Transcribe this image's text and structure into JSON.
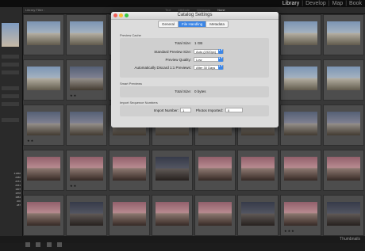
{
  "lightroom": {
    "module_picker": {
      "library": "Library",
      "develop": "Develop",
      "map": "Map",
      "book": "Book"
    },
    "filter_bar": {
      "left_label": "Library Filter :",
      "tabs": [
        "Text",
        "Attribute",
        "Metadata",
        "None"
      ],
      "active_tab": "None"
    },
    "left_panel": {
      "numbers": [
        "41860",
        "2080",
        "2151",
        "2041",
        "1907",
        "1878",
        "1884",
        "200",
        "287"
      ]
    },
    "grid": {
      "rating_label": "★★",
      "ratings": [
        "",
        "",
        "",
        "",
        "",
        "",
        "",
        "",
        "",
        "★★",
        "",
        "",
        "",
        "",
        "",
        "",
        "★★",
        "",
        "",
        "",
        "",
        "",
        "",
        "",
        "",
        "★★",
        "",
        "",
        "",
        "",
        "",
        "",
        "",
        "",
        "",
        "",
        "",
        "",
        "★★★",
        ""
      ]
    },
    "bottom_bar": {
      "right_label": "Thumbnails"
    }
  },
  "dialog": {
    "title": "Catalog Settings",
    "tabs": [
      "General",
      "File Handling",
      "Metadata"
    ],
    "active_tab": "File Handling",
    "preview_cache": {
      "section_label": "Preview Cache",
      "total_size_label": "Total Size:",
      "total_size_value": "1 GB",
      "standard_preview_size_label": "Standard Preview Size:",
      "standard_preview_size_value": "Auto (1920px)",
      "preview_quality_label": "Preview Quality:",
      "preview_quality_value": "Low",
      "discard_label": "Automatically Discard 1:1 Previews:",
      "discard_value": "After 30 Days"
    },
    "smart_previews": {
      "section_label": "Smart Previews",
      "total_size_label": "Total Size:",
      "total_size_value": "0 bytes"
    },
    "import_sequence": {
      "section_label": "Import Sequence Numbers",
      "import_number_label": "Import Number:",
      "import_number_value": "1",
      "photos_imported_label": "Photos Imported:",
      "photos_imported_value": "0"
    }
  }
}
